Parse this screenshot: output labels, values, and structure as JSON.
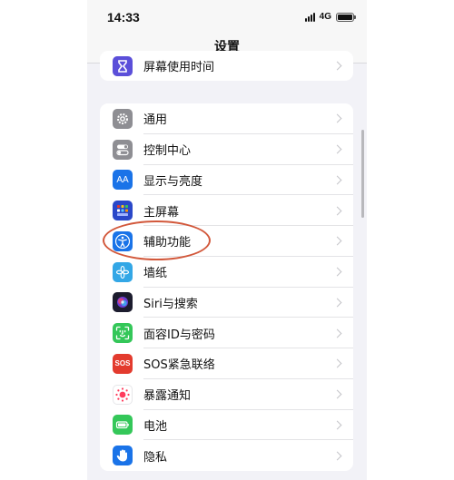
{
  "status": {
    "time": "14:33",
    "network": "4G"
  },
  "nav": {
    "title": "设置"
  },
  "top_group": [
    {
      "label": "屏幕使用时间",
      "icon": "hourglass-icon",
      "color": "#5b4fd9"
    }
  ],
  "main_group": [
    {
      "label": "通用",
      "icon": "gear-icon",
      "color": "#8e8e93"
    },
    {
      "label": "控制中心",
      "icon": "toggles-icon",
      "color": "#8e8e93"
    },
    {
      "label": "显示与亮度",
      "icon": "text-size-icon",
      "color": "#1a73e8",
      "glyph": "AA"
    },
    {
      "label": "主屏幕",
      "icon": "home-grid-icon",
      "color": "#2a48c9"
    },
    {
      "label": "辅助功能",
      "icon": "accessibility-icon",
      "color": "#1a73e8"
    },
    {
      "label": "墙纸",
      "icon": "flower-icon",
      "color": "#33a7e6"
    },
    {
      "label": "Siri与搜索",
      "icon": "siri-icon",
      "color": "#1c1c2e"
    },
    {
      "label": "面容ID与密码",
      "icon": "face-id-icon",
      "color": "#34c759"
    },
    {
      "label": "SOS紧急联络",
      "icon": "sos-icon",
      "color": "#e33b2e",
      "glyph": "SOS"
    },
    {
      "label": "暴露通知",
      "icon": "exposure-icon",
      "color": "#ffffff"
    },
    {
      "label": "电池",
      "icon": "battery-icon",
      "color": "#34c759"
    },
    {
      "label": "隐私",
      "icon": "hand-icon",
      "color": "#1a73e8"
    }
  ]
}
